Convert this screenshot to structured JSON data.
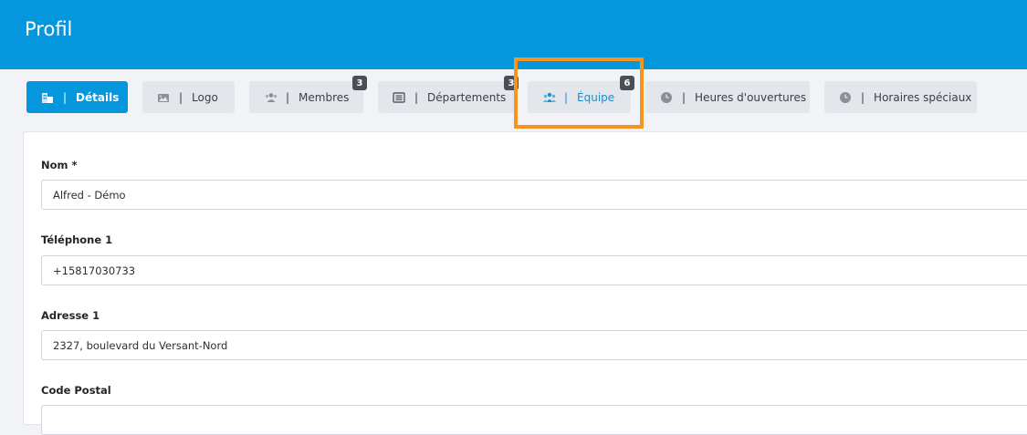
{
  "header": {
    "title": "Profil"
  },
  "tabs": [
    {
      "id": "details",
      "label": "Détails",
      "icon": "building-icon",
      "badge": null
    },
    {
      "id": "logo",
      "label": "Logo",
      "icon": "image-icon",
      "badge": null
    },
    {
      "id": "membres",
      "label": "Membres",
      "icon": "users-icon",
      "badge": "3"
    },
    {
      "id": "departements",
      "label": "Départements",
      "icon": "list-icon",
      "badge": "3"
    },
    {
      "id": "equipe",
      "label": "Équipe",
      "icon": "team-icon",
      "badge": "6"
    },
    {
      "id": "heures",
      "label": "Heures d'ouvertures",
      "icon": "clock-icon",
      "badge": null
    },
    {
      "id": "horaires",
      "label": "Horaires spéciaux",
      "icon": "clock-icon",
      "badge": null
    }
  ],
  "tab_separator": "|",
  "form": {
    "nom": {
      "label": "Nom *",
      "value": "Alfred - Démo"
    },
    "telephone1": {
      "label": "Téléphone 1",
      "value": "+15817030733"
    },
    "adresse1": {
      "label": "Adresse 1",
      "value": "2327, boulevard du Versant-Nord"
    },
    "code_postal": {
      "label": "Code Postal",
      "value": ""
    }
  },
  "colors": {
    "header": "#0597dd",
    "accent": "#0597dd",
    "highlight": "#f7931e",
    "badge": "#4a4f55",
    "tab_bg": "#e3e6ea"
  }
}
